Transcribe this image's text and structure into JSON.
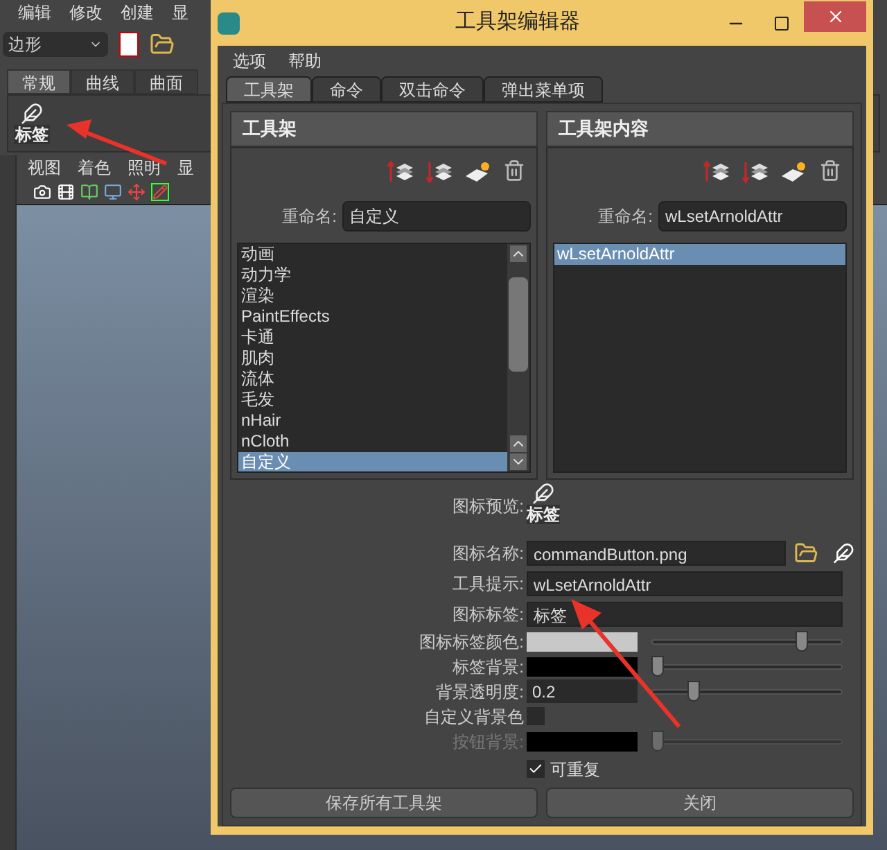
{
  "app": {
    "menu": [
      "编辑",
      "修改",
      "创建",
      "显"
    ],
    "mode_dropdown": "边形",
    "shelf_tabs": [
      {
        "label": "常规",
        "selected": true
      },
      {
        "label": "曲线",
        "selected": false
      },
      {
        "label": "曲面",
        "selected": false
      }
    ],
    "shelf_button": "标签",
    "viewport_menu": [
      "视图",
      "着色",
      "照明",
      "显"
    ]
  },
  "dialog": {
    "title": "工具架编辑器",
    "menu": [
      "选项",
      "帮助"
    ],
    "tabs": [
      {
        "label": "工具架",
        "selected": true
      },
      {
        "label": "命令",
        "selected": false
      },
      {
        "label": "双击命令",
        "selected": false
      },
      {
        "label": "弹出菜单项",
        "selected": false
      }
    ],
    "shelves": {
      "header": "工具架",
      "rename_label": "重命名:",
      "rename_value": "自定义",
      "items": [
        {
          "label": "动画",
          "selected": false
        },
        {
          "label": "动力学",
          "selected": false
        },
        {
          "label": "渲染",
          "selected": false
        },
        {
          "label": "PaintEffects",
          "selected": false
        },
        {
          "label": "卡通",
          "selected": false
        },
        {
          "label": "肌肉",
          "selected": false
        },
        {
          "label": "流体",
          "selected": false
        },
        {
          "label": "毛发",
          "selected": false
        },
        {
          "label": "nHair",
          "selected": false
        },
        {
          "label": "nCloth",
          "selected": false
        },
        {
          "label": "自定义",
          "selected": true
        }
      ]
    },
    "contents": {
      "header": "工具架内容",
      "rename_label": "重命名:",
      "rename_value": "wLsetArnoldAttr",
      "items": [
        {
          "label": "wLsetArnoldAttr",
          "selected": true
        }
      ]
    },
    "preview_label": "图标预览:",
    "preview_caption": "标签",
    "fields": [
      {
        "label": "图标名称:",
        "value": "commandButton.png"
      },
      {
        "label": "工具提示:",
        "value": "wLsetArnoldAttr"
      },
      {
        "label": "图标标签:",
        "value": "标签"
      }
    ],
    "color_rows": [
      {
        "kind": "swatch",
        "label": "图标标签颜色:",
        "color": "#c8c8c8",
        "level": 0.78,
        "disabled": false
      },
      {
        "kind": "swatch",
        "label": "标签背景:",
        "color": "#000000",
        "level": 0.03,
        "disabled": false
      },
      {
        "kind": "value",
        "label": "背景透明度:",
        "value": "0.2",
        "level": 0.22,
        "disabled": false
      },
      {
        "kind": "check",
        "label": "自定义背景色",
        "checked": false
      },
      {
        "kind": "swatch",
        "label": "按钮背景:",
        "color": "#000000",
        "level": 0.03,
        "disabled": true
      }
    ],
    "repeatable": {
      "label": "可重复",
      "checked": true
    },
    "buttons": [
      "保存所有工具架",
      "关闭"
    ]
  }
}
